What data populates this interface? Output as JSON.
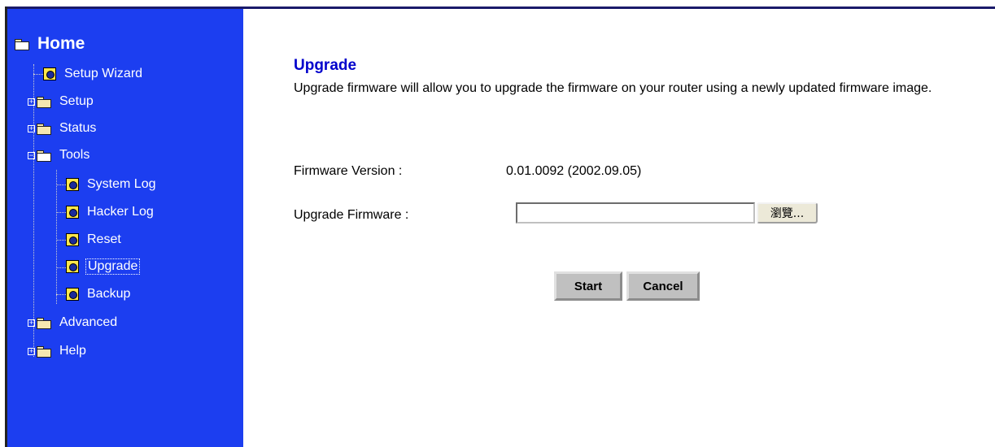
{
  "sidebar": {
    "home_label": "Home",
    "items": [
      {
        "label": "Setup Wizard"
      },
      {
        "label": "Setup"
      },
      {
        "label": "Status"
      },
      {
        "label": "Tools"
      },
      {
        "label": "System Log"
      },
      {
        "label": "Hacker Log"
      },
      {
        "label": "Reset"
      },
      {
        "label": "Upgrade"
      },
      {
        "label": "Backup"
      },
      {
        "label": "Advanced"
      },
      {
        "label": "Help"
      }
    ]
  },
  "main": {
    "title": "Upgrade",
    "description": "Upgrade firmware will allow you to upgrade the firmware on your router using a newly updated firmware image.",
    "firmware_version_label": "Firmware Version :",
    "firmware_version_value": "0.01.0092 (2002.09.05)",
    "upgrade_firmware_label": "Upgrade Firmware :",
    "upgrade_file_value": "",
    "browse_label": "瀏覽...",
    "start_label": "Start",
    "cancel_label": "Cancel"
  },
  "colors": {
    "sidebar_bg": "#1c3ef0",
    "title": "#0000cc"
  }
}
